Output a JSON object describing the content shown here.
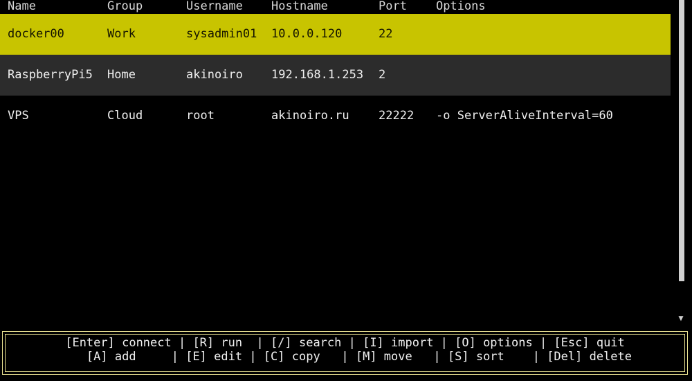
{
  "columns": {
    "name": "Name",
    "group": "Group",
    "username": "Username",
    "hostname": "Hostname",
    "port": "Port",
    "options": "Options"
  },
  "hosts": [
    {
      "name": "docker00",
      "group": "Work",
      "username": "sysadmin01",
      "hostname": "10.0.0.120",
      "port": "22",
      "options": ""
    },
    {
      "name": "RaspberryPi5",
      "group": "Home",
      "username": "akinoiro",
      "hostname": "192.168.1.253",
      "port": "2",
      "options": ""
    },
    {
      "name": "VPS",
      "group": "Cloud",
      "username": "root",
      "hostname": "akinoiro.ru",
      "port": "22222",
      "options": "-o ServerAliveInterval=60"
    }
  ],
  "scrollbar": {
    "down_arrow": "▼"
  },
  "help": {
    "line1": "[Enter] connect | [R] run  | [/] search | [I] import | [O] options | [Esc] quit",
    "line2": "    [A] add     | [E] edit | [C] copy   | [M] move   | [S] sort    | [Del] delete"
  },
  "colors": {
    "selected_row_bg": "#c8c400",
    "selected_row_fg": "#141400",
    "alt_row_bg": "#2c2c2c",
    "base_bg": "#000000",
    "text": "#f0f0f0",
    "border": "#e8e090"
  }
}
